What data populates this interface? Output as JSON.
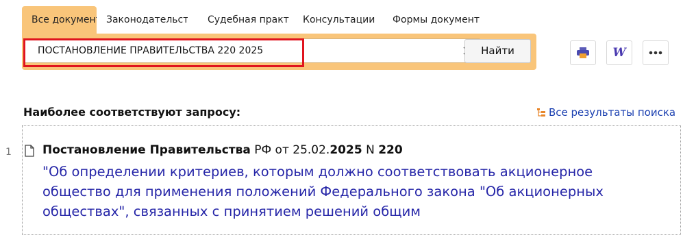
{
  "tabs": [
    {
      "label": "Все документы",
      "active": true
    },
    {
      "label": "Законодательств"
    },
    {
      "label": "Судебная практик"
    },
    {
      "label": "Консультации"
    },
    {
      "label": "Формы документ"
    }
  ],
  "search": {
    "query": "ПОСТАНОВЛЕНИЕ ПРАВИТЕЛЬСТВА 220 2025",
    "find_label": "Найти"
  },
  "toolbar": {
    "print_icon": "printer-icon",
    "word_glyph": "W",
    "more_icon": "more-dots-icon"
  },
  "results": {
    "title": "Наиболее соответствуют запросу:",
    "all_results_label": "Все результаты поиска",
    "items": [
      {
        "number": "1",
        "title_part1": "Постановление Правительства",
        "title_part2": " РФ от 25.02.",
        "title_year": "2025",
        "title_part3": " N ",
        "title_num": "220",
        "snippet": "\"Об определении критериев, которым должно соответствовать акционерное общество для применения положений Федерального закона \"Об акционерных обществах\", связанных с принятием решений общим"
      }
    ]
  },
  "colors": {
    "accent": "#f9c57a",
    "highlight_border": "#e0141e",
    "link": "#1a3fb0",
    "snippet": "#2626a8"
  }
}
